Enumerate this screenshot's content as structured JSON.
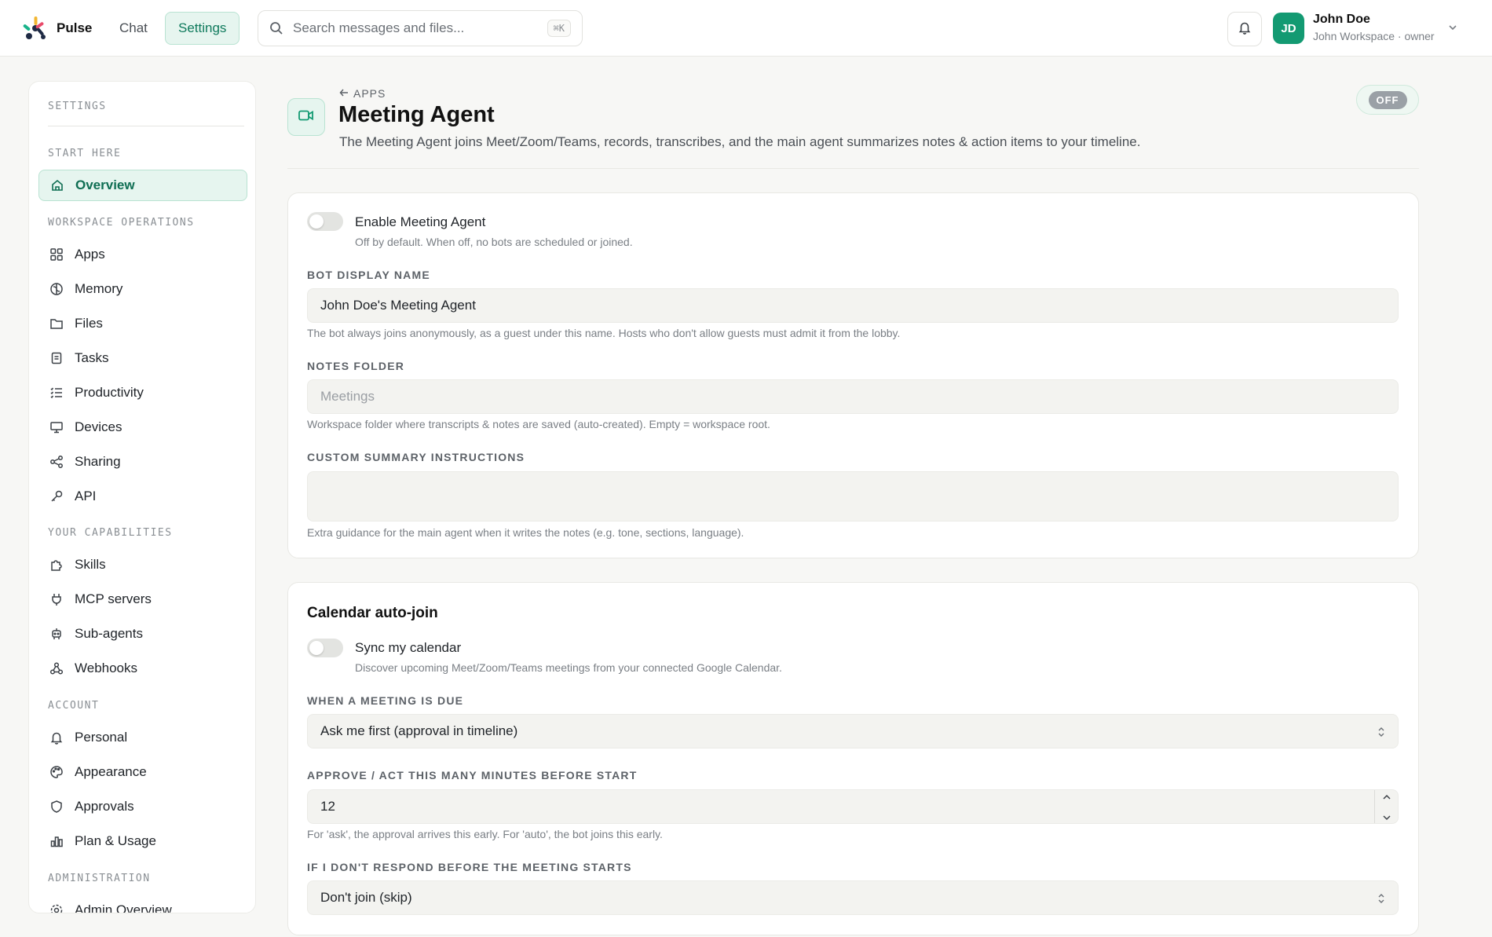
{
  "header": {
    "brand": "Pulse",
    "nav": {
      "chat": "Chat",
      "settings": "Settings"
    },
    "search": {
      "placeholder": "Search messages and files...",
      "shortcut": "⌘K"
    },
    "user": {
      "initials": "JD",
      "name": "John Doe",
      "subtitle": "John Workspace · owner"
    }
  },
  "sidebar": {
    "heading": "SETTINGS",
    "sections": {
      "start_here": "START HERE",
      "workspace_operations": "WORKSPACE OPERATIONS",
      "your_capabilities": "YOUR CAPABILITIES",
      "account": "ACCOUNT",
      "administration": "ADMINISTRATION"
    },
    "items": {
      "overview": "Overview",
      "apps": "Apps",
      "memory": "Memory",
      "files": "Files",
      "tasks": "Tasks",
      "productivity": "Productivity",
      "devices": "Devices",
      "sharing": "Sharing",
      "api": "API",
      "skills": "Skills",
      "mcp_servers": "MCP servers",
      "sub_agents": "Sub-agents",
      "webhooks": "Webhooks",
      "personal": "Personal",
      "appearance": "Appearance",
      "approvals": "Approvals",
      "plan_usage": "Plan & Usage",
      "admin_overview": "Admin Overview"
    },
    "active": "overview"
  },
  "main": {
    "back_label": "APPS",
    "title": "Meeting Agent",
    "description": "The Meeting Agent joins Meet/Zoom/Teams, records, transcribes, and the main agent summarizes notes & action items to your timeline.",
    "status": "OFF",
    "general": {
      "enable_label": "Enable Meeting Agent",
      "enable_help": "Off by default. When off, no bots are scheduled or joined.",
      "enable_on": false,
      "bot_name_label": "BOT DISPLAY NAME",
      "bot_name_value": "John Doe's Meeting Agent",
      "bot_name_help": "The bot always joins anonymously, as a guest under this name. Hosts who don't allow guests must admit it from the lobby.",
      "notes_folder_label": "NOTES FOLDER",
      "notes_folder_placeholder": "Meetings",
      "notes_folder_help": "Workspace folder where transcripts & notes are saved (auto-created). Empty = workspace root.",
      "custom_summary_label": "CUSTOM SUMMARY INSTRUCTIONS",
      "custom_summary_value": "",
      "custom_summary_help": "Extra guidance for the main agent when it writes the notes (e.g. tone, sections, language)."
    },
    "calendar": {
      "title": "Calendar auto-join",
      "sync_label": "Sync my calendar",
      "sync_help": "Discover upcoming Meet/Zoom/Teams meetings from your connected Google Calendar.",
      "sync_on": false,
      "due_label": "WHEN A MEETING IS DUE",
      "due_value": "Ask me first (approval in timeline)",
      "minutes_label": "APPROVE / ACT THIS MANY MINUTES BEFORE START",
      "minutes_value": "12",
      "minutes_help": "For 'ask', the approval arrives this early. For 'auto', the bot joins this early.",
      "no_response_label": "IF I DON'T RESPOND BEFORE THE MEETING STARTS",
      "no_response_value": "Don't join (skip)"
    }
  },
  "colors": {
    "accent": "#139a72",
    "accent_soft": "#e6f5ef",
    "background": "#f7f7f5"
  }
}
